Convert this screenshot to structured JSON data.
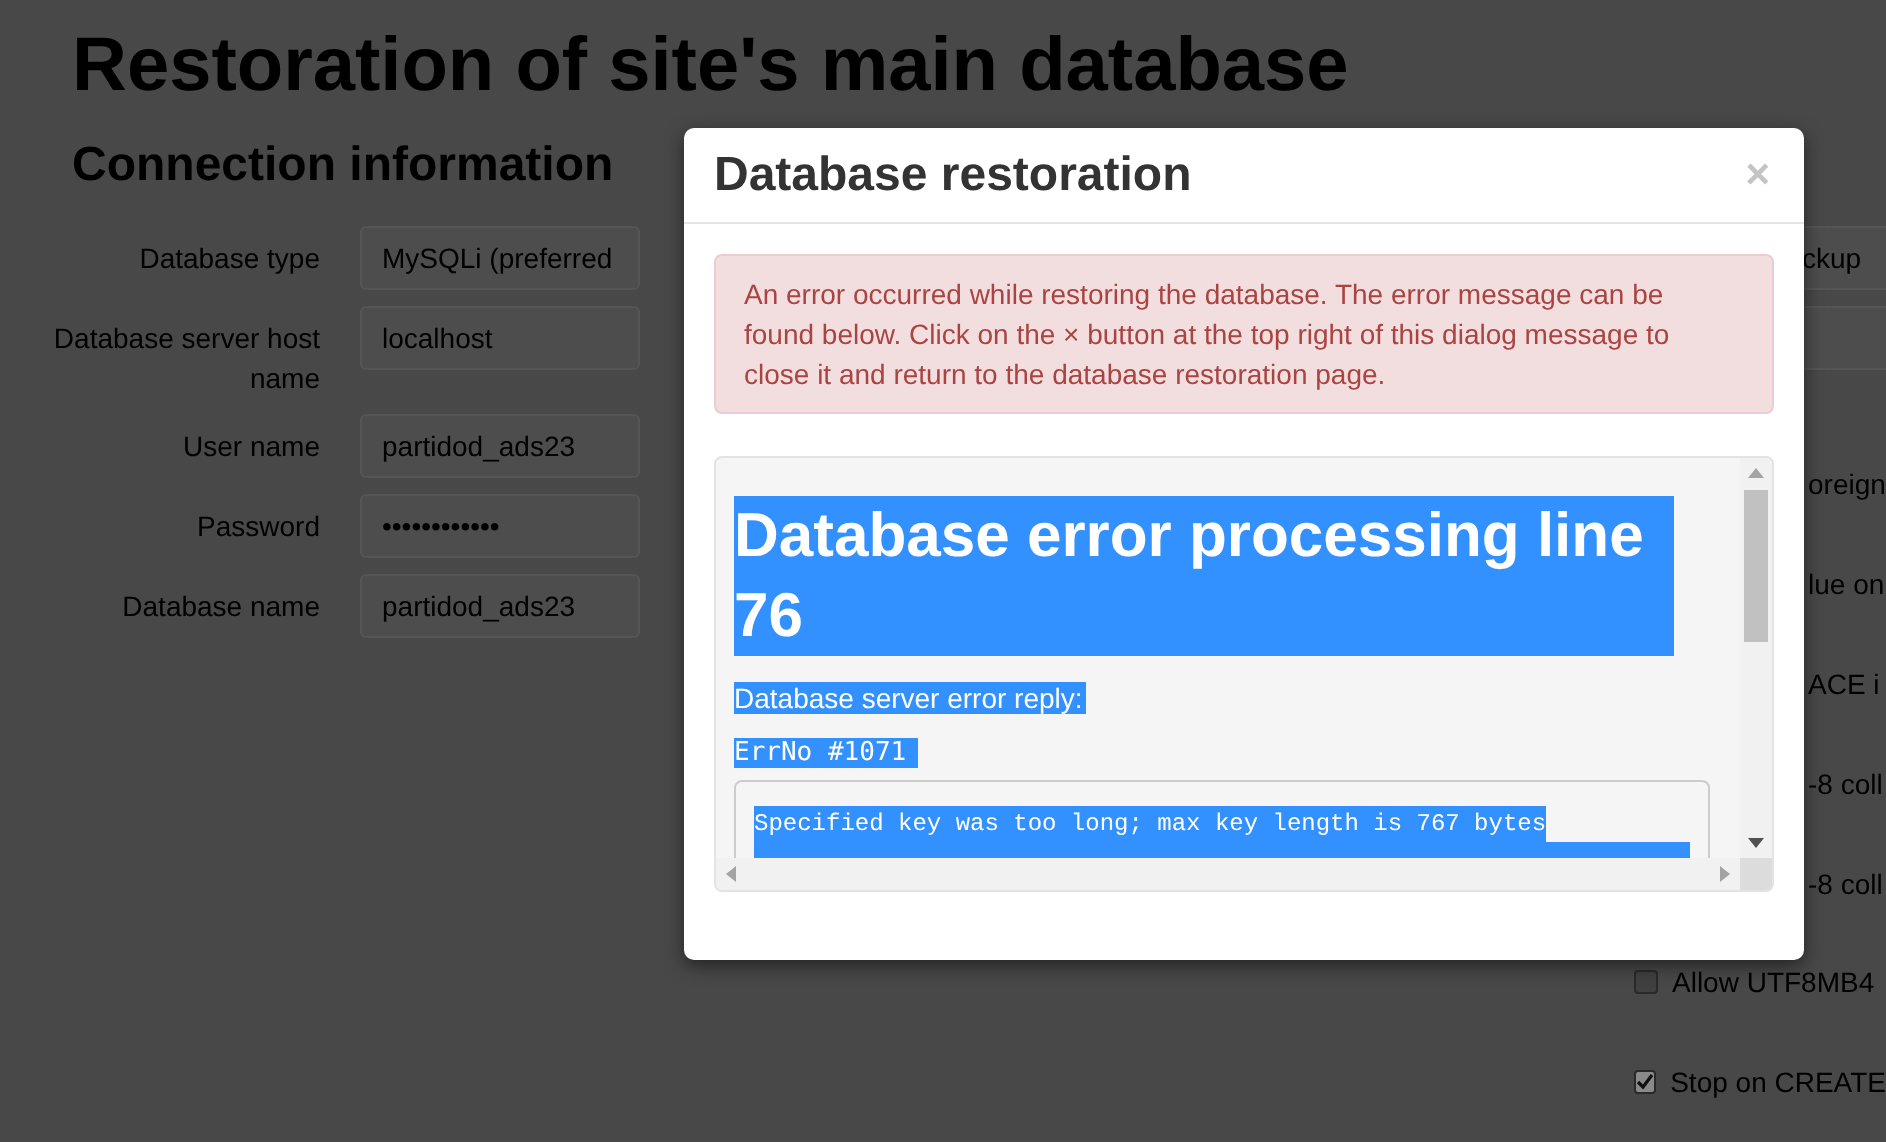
{
  "page": {
    "title": "Restoration of site's main database",
    "section": "Connection information",
    "fields": [
      {
        "label": "Database type",
        "value": "MySQLi (preferred"
      },
      {
        "label": "Database server host name",
        "value": "localhost"
      },
      {
        "label": "User name",
        "value": "partidod_ads23"
      },
      {
        "label": "Password",
        "value": "••••••••••••"
      },
      {
        "label": "Database name",
        "value": "partidod_ads23"
      }
    ],
    "right_fields": [
      {
        "value": "ckup"
      }
    ],
    "options": [
      {
        "kind": "partial",
        "label": "oreign"
      },
      {
        "kind": "partial",
        "label": "lue on"
      },
      {
        "kind": "partial",
        "label": "ACE i"
      },
      {
        "kind": "partial",
        "label": "-8 coll"
      },
      {
        "kind": "partial",
        "label": "-8 coll"
      },
      {
        "kind": "checkbox",
        "label": "Allow UTF8MB4",
        "checked": false
      },
      {
        "kind": "checkbox",
        "label": "Stop on CREATE",
        "checked": true
      }
    ]
  },
  "dialog": {
    "title": "Database restoration",
    "close": "×",
    "alert": "An error occurred while restoring the database. The error message can be found below. Click on the × button at the top right of this dialog message to close it and return to the database restoration page.",
    "error": {
      "heading": "Database error processing line 76",
      "subheading": "Database server error reply:",
      "errno": "ErrNo #1071",
      "lines": [
        "Specified key was too long; max key length is 767 bytes"
      ]
    }
  }
}
